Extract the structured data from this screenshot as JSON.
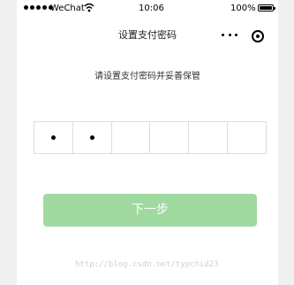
{
  "status_bar": {
    "carrier": "WeChat",
    "time": "10:06",
    "battery_percent": "100%",
    "signal_bars": 5
  },
  "nav": {
    "title": "设置支付密码",
    "menu_icon": "more-icon",
    "close_icon": "close-icon"
  },
  "instruction": "请设置支付密码并妥善保管",
  "pin": {
    "length": 6,
    "filled": 2
  },
  "next_button": {
    "label": "下一步"
  },
  "watermark": "http://blog.csdn.net/typchid23",
  "colors": {
    "button_bg": "#a0d9a0",
    "border": "#dddddd",
    "page_bg": "#ffffff"
  }
}
